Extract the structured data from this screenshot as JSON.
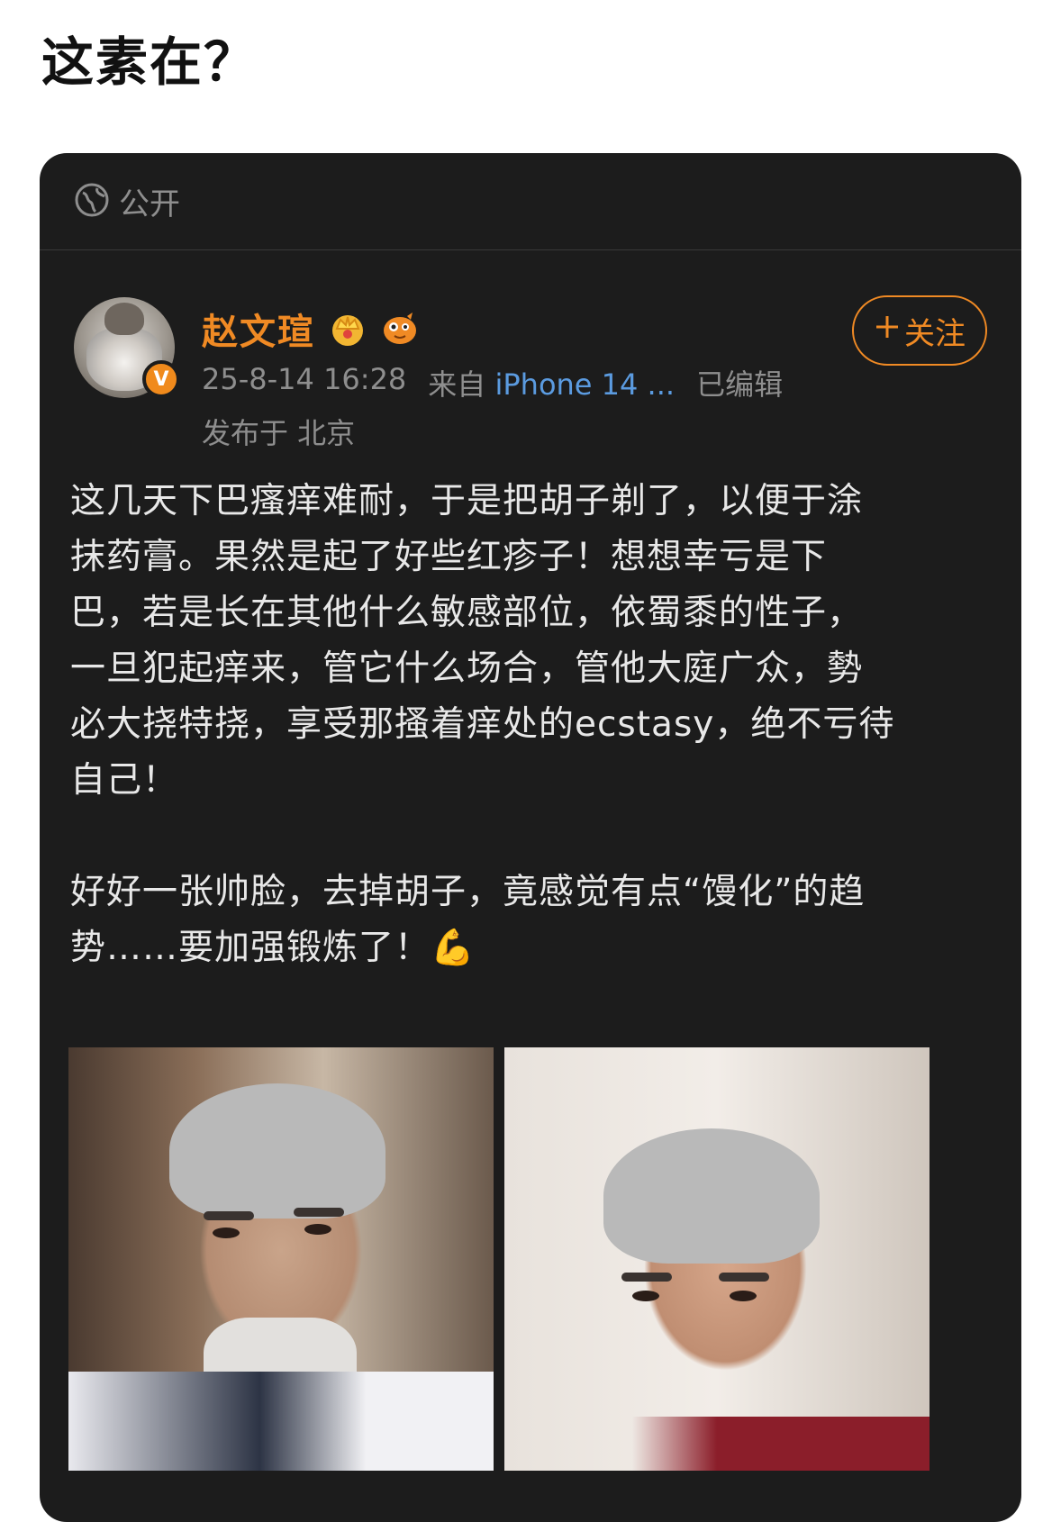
{
  "page": {
    "title": "这素在？"
  },
  "card": {
    "visibility": {
      "icon": "globe-icon",
      "label": "公开"
    },
    "author": {
      "name": "赵文瑄",
      "avatar": "avatar",
      "badges": [
        "crown-icon",
        "emoji-badge-icon"
      ],
      "verified_badge": "V"
    },
    "follow_button": {
      "label": "关注",
      "icon": "plus-icon"
    },
    "meta": {
      "date": "25-8-14 16:28",
      "source_prefix": "来自",
      "device": "iPhone 14 ...",
      "edited": "已编辑"
    },
    "location": "发布于 北京",
    "body": "这几天下巴瘙痒难耐，于是把胡子剃了，以便于涂\n抹药膏。果然是起了好些红疹子！想想幸亏是下\n巴，若是长在其他什么敏感部位，依蜀黍的性子，\n一旦犯起痒来，管它什么场合，管他大庭广众，勢\n必大挠特挠，享受那搔着痒处的ecstasy，绝不亏待\n自己！\n\n好好一张帅脸，去掉胡子，竟感觉有点“馒化”的趋\n势……要加强锻炼了！💪",
    "colors": {
      "card_bg": "#1c1c1c",
      "accent": "#f08a24",
      "link": "#5b9be0",
      "muted": "#8e8e8e"
    }
  }
}
